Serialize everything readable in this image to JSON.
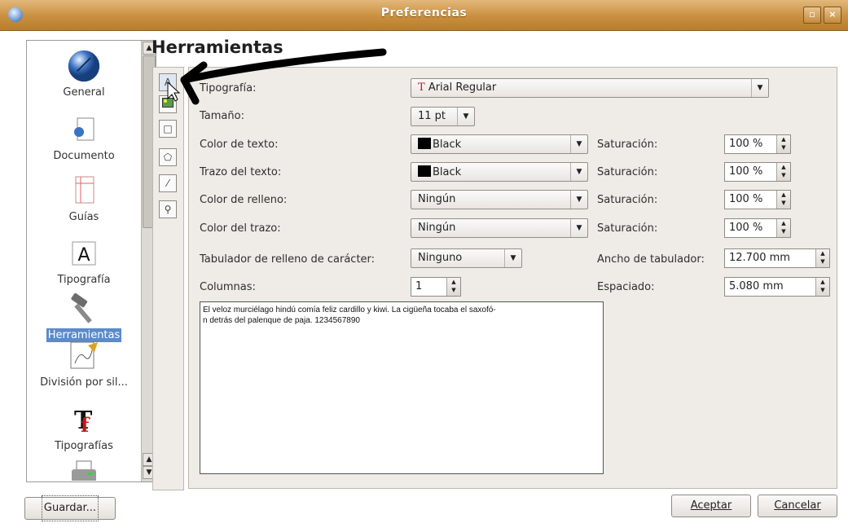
{
  "window": {
    "title": "Preferencias"
  },
  "sidebar": {
    "items": [
      {
        "label": "General",
        "icon": "globe-icon"
      },
      {
        "label": "Documento",
        "icon": "document-icon"
      },
      {
        "label": "Guías",
        "icon": "guides-icon"
      },
      {
        "label": "Tipografía",
        "icon": "typography-icon"
      },
      {
        "label": "Herramientas",
        "icon": "hammer-icon",
        "selected": true
      },
      {
        "label": "División por sil...",
        "icon": "hyphenation-icon"
      },
      {
        "label": "Tipografías",
        "icon": "fonts-icon"
      },
      {
        "label": "",
        "icon": "printer-icon"
      }
    ]
  },
  "section": {
    "title": "Herramientas"
  },
  "tools": [
    "text-tool-icon",
    "image-tool-icon",
    "rectangle-tool-icon",
    "polygon-tool-icon",
    "line-tool-icon",
    "zoom-tool-icon"
  ],
  "form": {
    "font_label": "Tipografía:",
    "font_value": "Arial Regular",
    "size_label": "Tamaño:",
    "size_value": "11 pt",
    "text_color_label": "Color de texto:",
    "text_color_value": "Black",
    "text_stroke_label": "Trazo del texto:",
    "text_stroke_value": "Black",
    "fill_color_label": "Color de relleno:",
    "fill_color_value": "Ningún",
    "stroke_color_label": "Color del trazo:",
    "stroke_color_value": "Ningún",
    "saturation_label": "Saturación:",
    "saturation_1": "100 %",
    "saturation_2": "100 %",
    "saturation_3": "100 %",
    "saturation_4": "100 %",
    "tab_fill_label": "Tabulador de relleno de carácter:",
    "tab_fill_value": "Ninguno",
    "tab_width_label": "Ancho de tabulador:",
    "tab_width_value": "12.700 mm",
    "columns_label": "Columnas:",
    "columns_value": "1",
    "spacing_label": "Espaciado:",
    "spacing_value": "5.080 mm",
    "preview_text": "El veloz murciélago hindú comía feliz cardillo y kiwi. La cigüeña tocaba el saxofó-\nn detrás del palenque de paja. 1234567890"
  },
  "buttons": {
    "save": "Guardar...",
    "accept": "Aceptar",
    "cancel": "Cancelar"
  },
  "colors": {
    "titlebar": "#c98f3f",
    "selection": "#5b8bc9",
    "window_bg": "#efebe7"
  }
}
